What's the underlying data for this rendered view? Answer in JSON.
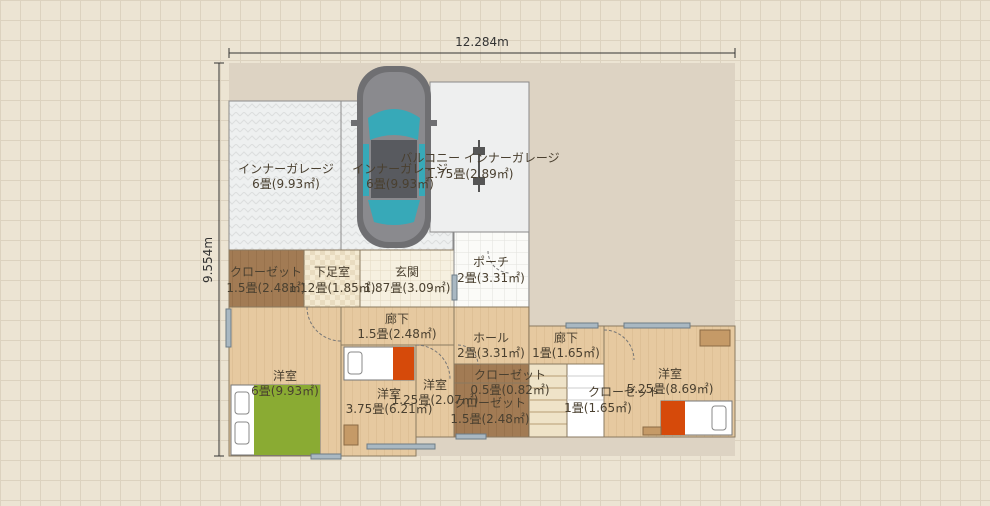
{
  "dimensions": {
    "width": "12.284m",
    "height": "9.554m"
  },
  "rooms": {
    "garage_left": {
      "name": "インナーガレージ",
      "size": "6畳(9.93㎡)"
    },
    "garage_center": {
      "name": "インナーガレージ",
      "size": "6畳(9.93㎡)"
    },
    "garage_right": {
      "name": "バルコニー インナーガレージ",
      "size": "1.75畳(2.89㎡)"
    },
    "closet_top": {
      "name": "クローゼット",
      "size": "1.5畳(2.48㎡)"
    },
    "shoe_room": {
      "name": "下足室",
      "size": "1.12畳(1.85㎡)"
    },
    "entrance": {
      "name": "玄関",
      "size": "1.87畳(3.09㎡)"
    },
    "porch": {
      "name": "ポーチ",
      "size": "2畳(3.31㎡)"
    },
    "corridor_left": {
      "name": "廊下",
      "size": "1.5畳(2.48㎡)"
    },
    "hall": {
      "name": "ホール",
      "size": "2畳(3.31㎡)"
    },
    "corridor_right": {
      "name": "廊下",
      "size": "1畳(1.65㎡)"
    },
    "western_left": {
      "name": "洋室",
      "size": "6畳(9.93㎡)"
    },
    "western_mid": {
      "name": "洋室",
      "size": "3.75畳(6.21㎡)"
    },
    "western_small": {
      "name": "洋室",
      "size": "1.25畳(2.07㎡)"
    },
    "closet_mid": {
      "name": "クローゼット",
      "size": "0.5畳(0.82㎡)"
    },
    "closet_bottom": {
      "name": "クローゼット",
      "size": "1.5畳(2.48㎡)"
    },
    "closet_right": {
      "name": "クローゼット",
      "size": "1畳(1.65㎡)"
    },
    "western_right": {
      "name": "洋室",
      "size": "5.25畳(8.69㎡)"
    }
  }
}
